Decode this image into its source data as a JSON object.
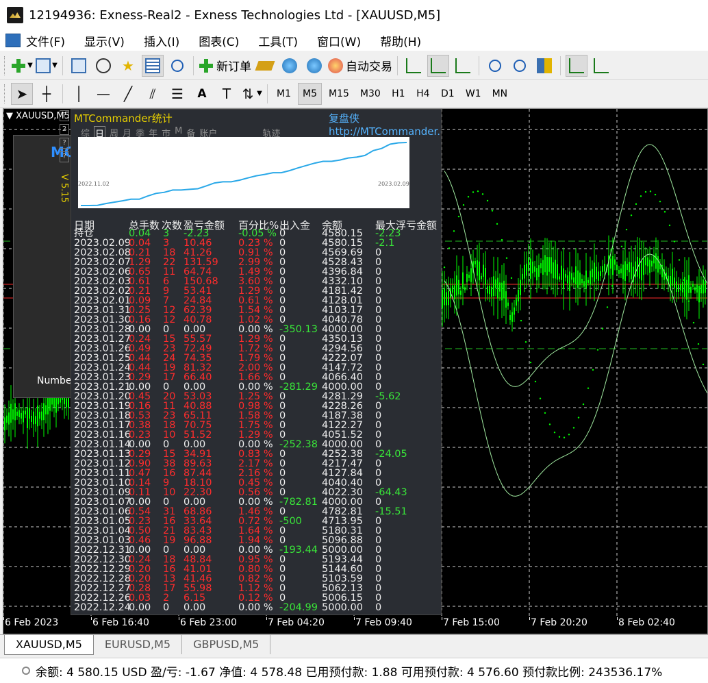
{
  "window": {
    "title": "12194936: Exness-Real2 - Exness Technologies Ltd - [XAUUSD,M5]"
  },
  "menu": [
    "文件(F)",
    "显示(V)",
    "插入(I)",
    "图表(C)",
    "工具(T)",
    "窗口(W)",
    "帮助(H)"
  ],
  "toolbar": {
    "new_order": "新订单",
    "auto_trade": "自动交易"
  },
  "drawing_tools": {
    "text_tool": "A"
  },
  "timeframes": [
    "M1",
    "M5",
    "M15",
    "M30",
    "H1",
    "H4",
    "D1",
    "W1",
    "MN"
  ],
  "active_timeframe": "M5",
  "chart": {
    "symbol": "XAUUSD,M5",
    "x_labels": [
      "6 Feb 2023",
      "6 Feb 16:40",
      "6 Feb 23:00",
      "7 Feb 04:20",
      "7 Feb 09:40",
      "7 Feb 15:00",
      "7 Feb 20:20",
      "8 Feb 02:40"
    ]
  },
  "left_panel": {
    "logo": "MC",
    "version": "V 5.15",
    "number_label": "Numbe"
  },
  "side_tools": [
    "?",
    "2",
    "?",
    "?"
  ],
  "stats": {
    "title": "MTCommander统计",
    "link": "复盘侠 http://MTCommander.com",
    "tabs": [
      "综",
      "日",
      "周",
      "月",
      "季",
      "年",
      "市",
      "M",
      "备",
      "账户",
      "轨迹"
    ],
    "active_tab": "日",
    "curve_start": "2022.11.02",
    "curve_end": "2023.02.09",
    "columns": [
      "日期",
      "总手数",
      "次数",
      "盈亏金额",
      "百分比%",
      "出入金",
      "余额",
      "最大浮亏金额"
    ],
    "rows": [
      [
        "持仓",
        "0.04",
        "3",
        "-2.23",
        "-0.05 %",
        "0",
        "4580.15",
        "-2.23"
      ],
      [
        "2023.02.09",
        "0.04",
        "3",
        "10.46",
        "0.23 %",
        "0",
        "4580.15",
        "-2.1"
      ],
      [
        "2023.02.08",
        "0.21",
        "18",
        "41.26",
        "0.91 %",
        "0",
        "4569.69",
        "0"
      ],
      [
        "2023.02.07",
        "1.29",
        "22",
        "131.59",
        "2.99 %",
        "0",
        "4528.43",
        "0"
      ],
      [
        "2023.02.06",
        "0.65",
        "11",
        "64.74",
        "1.49 %",
        "0",
        "4396.84",
        "0"
      ],
      [
        "2023.02.03",
        "0.61",
        "6",
        "150.68",
        "3.60 %",
        "0",
        "4332.10",
        "0"
      ],
      [
        "2023.02.02",
        "0.21",
        "9",
        "53.41",
        "1.29 %",
        "0",
        "4181.42",
        "0"
      ],
      [
        "2023.02.01",
        "0.09",
        "7",
        "24.84",
        "0.61 %",
        "0",
        "4128.01",
        "0"
      ],
      [
        "2023.01.31",
        "0.25",
        "12",
        "62.39",
        "1.54 %",
        "0",
        "4103.17",
        "0"
      ],
      [
        "2023.01.30",
        "0.16",
        "12",
        "40.78",
        "1.02 %",
        "0",
        "4040.78",
        "0"
      ],
      [
        "2023.01.28",
        "0.00",
        "0",
        "0.00",
        "0.00 %",
        "-350.13",
        "4000.00",
        "0"
      ],
      [
        "2023.01.27",
        "0.24",
        "15",
        "55.57",
        "1.29 %",
        "0",
        "4350.13",
        "0"
      ],
      [
        "2023.01.26",
        "0.49",
        "23",
        "72.49",
        "1.72 %",
        "0",
        "4294.56",
        "0"
      ],
      [
        "2023.01.25",
        "0.44",
        "24",
        "74.35",
        "1.79 %",
        "0",
        "4222.07",
        "0"
      ],
      [
        "2023.01.24",
        "0.44",
        "19",
        "81.32",
        "2.00 %",
        "0",
        "4147.72",
        "0"
      ],
      [
        "2023.01.23",
        "0.29",
        "17",
        "66.40",
        "1.66 %",
        "0",
        "4066.40",
        "0"
      ],
      [
        "2023.01.21",
        "0.00",
        "0",
        "0.00",
        "0.00 %",
        "-281.29",
        "4000.00",
        "0"
      ],
      [
        "2023.01.20",
        "0.45",
        "20",
        "53.03",
        "1.25 %",
        "0",
        "4281.29",
        "-5.62"
      ],
      [
        "2023.01.19",
        "0.16",
        "11",
        "40.88",
        "0.98 %",
        "0",
        "4228.26",
        "0"
      ],
      [
        "2023.01.18",
        "0.53",
        "23",
        "65.11",
        "1.58 %",
        "0",
        "4187.38",
        "0"
      ],
      [
        "2023.01.17",
        "0.38",
        "18",
        "70.75",
        "1.75 %",
        "0",
        "4122.27",
        "0"
      ],
      [
        "2023.01.16",
        "0.23",
        "10",
        "51.52",
        "1.29 %",
        "0",
        "4051.52",
        "0"
      ],
      [
        "2023.01.14",
        "0.00",
        "0",
        "0.00",
        "0.00 %",
        "-252.38",
        "4000.00",
        "0"
      ],
      [
        "2023.01.13",
        "0.29",
        "15",
        "34.91",
        "0.83 %",
        "0",
        "4252.38",
        "-24.05"
      ],
      [
        "2023.01.12",
        "0.90",
        "38",
        "89.63",
        "2.17 %",
        "0",
        "4217.47",
        "0"
      ],
      [
        "2023.01.11",
        "0.47",
        "16",
        "87.44",
        "2.16 %",
        "0",
        "4127.84",
        "0"
      ],
      [
        "2023.01.10",
        "0.14",
        "9",
        "18.10",
        "0.45 %",
        "0",
        "4040.40",
        "0"
      ],
      [
        "2023.01.09",
        "0.11",
        "10",
        "22.30",
        "0.56 %",
        "0",
        "4022.30",
        "-64.43"
      ],
      [
        "2023.01.07",
        "0.00",
        "0",
        "0.00",
        "0.00 %",
        "-782.81",
        "4000.00",
        "0"
      ],
      [
        "2023.01.06",
        "0.54",
        "31",
        "68.86",
        "1.46 %",
        "0",
        "4782.81",
        "-15.51"
      ],
      [
        "2023.01.05",
        "0.23",
        "16",
        "33.64",
        "0.72 %",
        "-500",
        "4713.95",
        "0"
      ],
      [
        "2023.01.04",
        "0.50",
        "21",
        "83.43",
        "1.64 %",
        "0",
        "5180.31",
        "0"
      ],
      [
        "2023.01.03",
        "0.46",
        "19",
        "96.88",
        "1.94 %",
        "0",
        "5096.88",
        "0"
      ],
      [
        "2022.12.31",
        "0.00",
        "0",
        "0.00",
        "0.00 %",
        "-193.44",
        "5000.00",
        "0"
      ],
      [
        "2022.12.30",
        "0.24",
        "18",
        "48.84",
        "0.95 %",
        "0",
        "5193.44",
        "0"
      ],
      [
        "2022.12.29",
        "0.20",
        "16",
        "41.01",
        "0.80 %",
        "0",
        "5144.60",
        "0"
      ],
      [
        "2022.12.28",
        "0.20",
        "13",
        "41.46",
        "0.82 %",
        "0",
        "5103.59",
        "0"
      ],
      [
        "2022.12.27",
        "0.28",
        "17",
        "55.98",
        "1.12 %",
        "0",
        "5062.13",
        "0"
      ],
      [
        "2022.12.26",
        "0.03",
        "2",
        "6.15",
        "0.12 %",
        "0",
        "5006.15",
        "0"
      ],
      [
        "2022.12.24",
        "0.00",
        "0",
        "0.00",
        "0.00 %",
        "-204.99",
        "5000.00",
        "0"
      ]
    ]
  },
  "symbol_tabs": [
    "XAUUSD,M5",
    "EURUSD,M5",
    "GBPUSD,M5"
  ],
  "active_symbol_tab": "XAUUSD,M5",
  "status": {
    "text": "余额: 4 580.15 USD  盈/亏: -1.67  净值: 4 578.48  已用预付款: 1.88  可用预付款: 4 576.60  预付款比例: 243536.17%"
  },
  "colors": {
    "chart_bg": "#000000",
    "candle": "#00ff00",
    "loss": "#ff2d2d",
    "gain": "#39e639",
    "link": "#55b4ff",
    "accent_yellow": "#e8d000"
  }
}
